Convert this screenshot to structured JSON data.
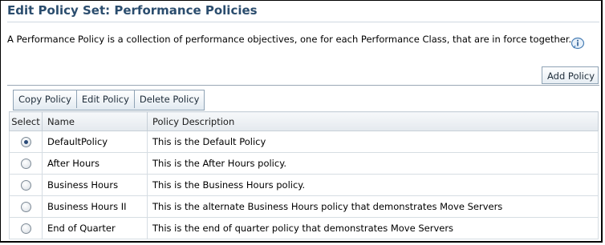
{
  "page": {
    "title": "Edit Policy Set: Performance Policies",
    "description": "A Performance Policy is a collection of performance objectives, one for each Performance Class, that are in force together."
  },
  "actions": {
    "add_policy": "Add Policy"
  },
  "toolbar": {
    "copy": "Copy Policy",
    "edit": "Edit Policy",
    "delete": "Delete Policy"
  },
  "table": {
    "headers": {
      "select": "Select",
      "name": "Name",
      "description": "Policy Description"
    },
    "rows": [
      {
        "selected": true,
        "name": "DefaultPolicy",
        "description": "This is the Default Policy"
      },
      {
        "selected": false,
        "name": "After Hours",
        "description": "This is the After Hours policy."
      },
      {
        "selected": false,
        "name": "Business Hours",
        "description": "This is the Business Hours policy."
      },
      {
        "selected": false,
        "name": "Business Hours II",
        "description": "This is the alternate Business Hours policy that demonstrates Move Servers"
      },
      {
        "selected": false,
        "name": "End of Quarter",
        "description": "This is the end of quarter policy that demonstrates Move Servers"
      }
    ]
  },
  "icons": {
    "info": "info-icon"
  },
  "colors": {
    "title": "#2b4d6e",
    "radio_selected": "#2a4a78"
  }
}
